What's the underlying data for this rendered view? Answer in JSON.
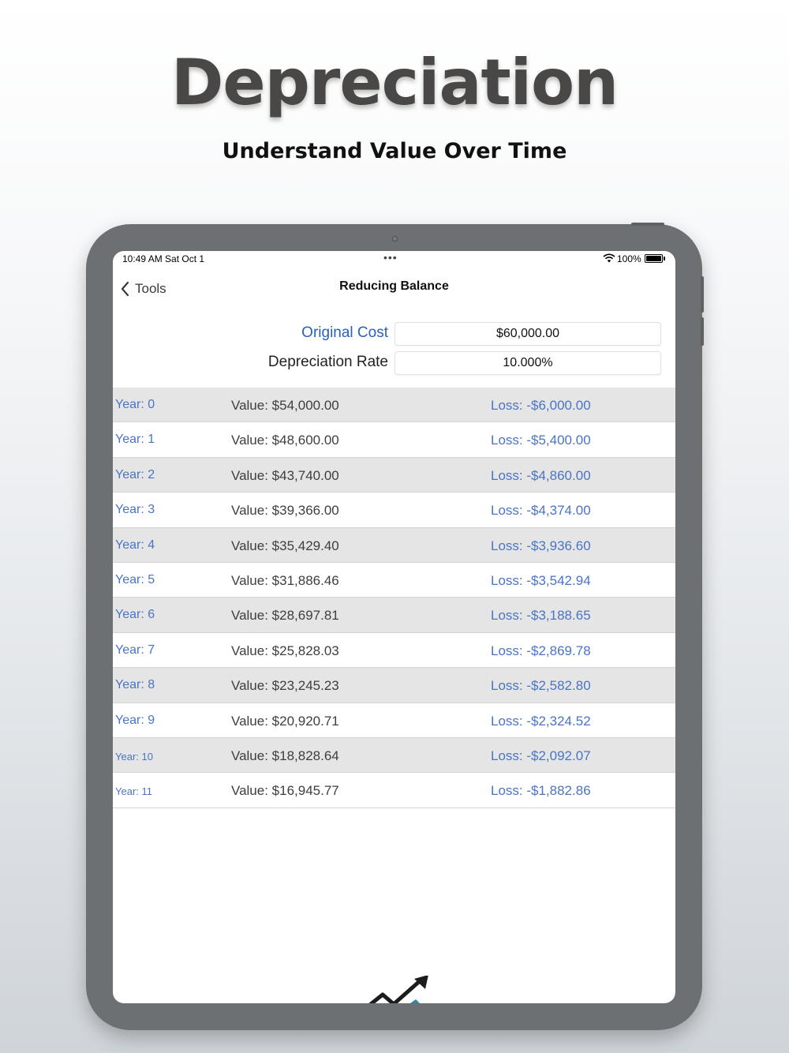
{
  "headline": "Depreciation",
  "subheadline": "Understand Value Over Time",
  "status_bar": {
    "time": "10:49 AM   Sat Oct 1",
    "battery": "100%"
  },
  "nav": {
    "back_label": "Tools",
    "title": "Reducing Balance"
  },
  "form": {
    "original_cost_label": "Original Cost",
    "original_cost_value": "$60,000.00",
    "rate_label": "Depreciation Rate",
    "rate_value": "10.000%"
  },
  "schedule": [
    {
      "year": "Year: 0",
      "value": "Value: $54,000.00",
      "loss": "Loss: -$6,000.00"
    },
    {
      "year": "Year: 1",
      "value": "Value: $48,600.00",
      "loss": "Loss: -$5,400.00"
    },
    {
      "year": "Year: 2",
      "value": "Value: $43,740.00",
      "loss": "Loss: -$4,860.00"
    },
    {
      "year": "Year: 3",
      "value": "Value: $39,366.00",
      "loss": "Loss: -$4,374.00"
    },
    {
      "year": "Year: 4",
      "value": "Value: $35,429.40",
      "loss": "Loss: -$3,936.60"
    },
    {
      "year": "Year: 5",
      "value": "Value: $31,886.46",
      "loss": "Loss: -$3,542.94"
    },
    {
      "year": "Year: 6",
      "value": "Value: $28,697.81",
      "loss": "Loss: -$3,188.65"
    },
    {
      "year": "Year: 7",
      "value": "Value: $25,828.03",
      "loss": "Loss: -$2,869.78"
    },
    {
      "year": "Year: 8",
      "value": "Value: $23,245.23",
      "loss": "Loss: -$2,582.80"
    },
    {
      "year": "Year: 9",
      "value": "Value: $20,920.71",
      "loss": "Loss: -$2,324.52"
    },
    {
      "year": "Year: 10",
      "value": "Value: $18,828.64",
      "loss": "Loss: -$2,092.07"
    },
    {
      "year": "Year: 11",
      "value": "Value: $16,945.77",
      "loss": "Loss: -$1,882.86"
    }
  ],
  "colors": {
    "accent_blue": "#4a74c4",
    "label_blue": "#2a62b8",
    "row_shade": "#e5e5e5",
    "device_frame": "#6d7072"
  },
  "icons": [
    "chevron-left-icon",
    "wifi-icon",
    "battery-icon",
    "trend-arrow-logo-icon"
  ]
}
